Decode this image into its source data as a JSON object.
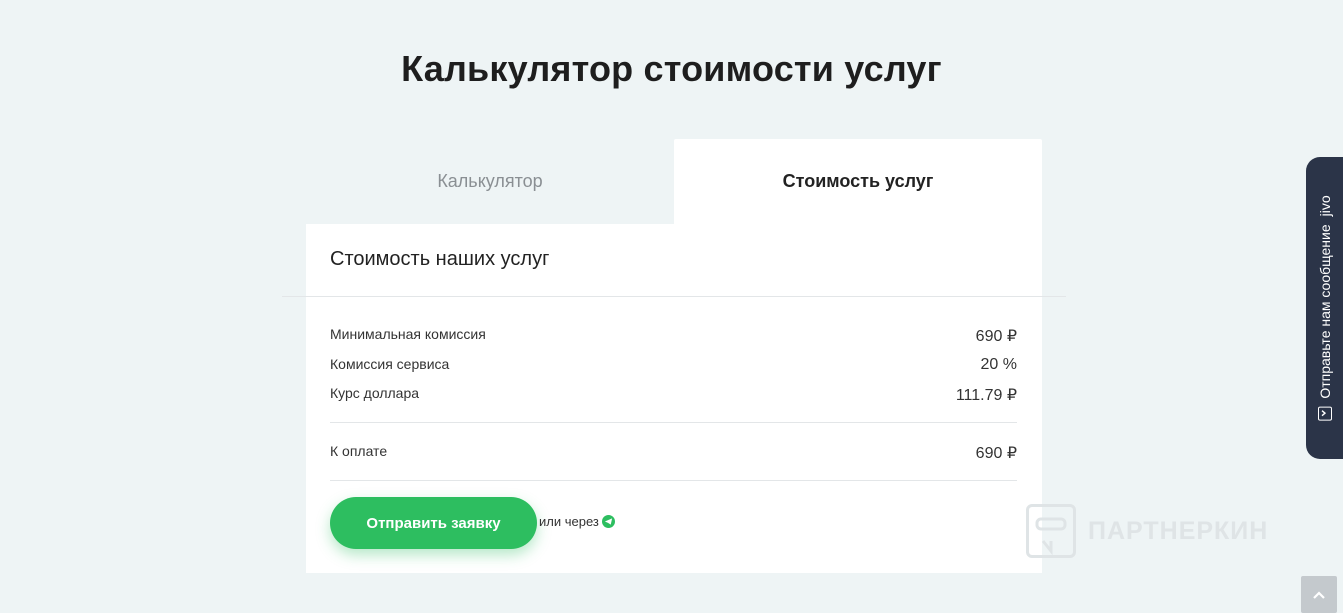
{
  "page": {
    "title": "Калькулятор стоимости услуг"
  },
  "tabs": [
    {
      "label": "Калькулятор",
      "active": false
    },
    {
      "label": "Стоимость услуг",
      "active": true
    }
  ],
  "card": {
    "title": "Стоимость наших услуг",
    "rows": [
      {
        "label": "Минимальная комиссия",
        "value": "690 ₽"
      },
      {
        "label": "Комиссия сервиса",
        "value": "20 %"
      },
      {
        "label": "Курс доллара",
        "value": "111.79 ₽"
      }
    ],
    "total": {
      "label": "К оплате",
      "value": "690 ₽"
    },
    "submit_label": "Отправить заявку",
    "or_via": "или через"
  },
  "chat_widget": {
    "label": "Отправьте нам сообщение",
    "brand": "jivo"
  },
  "watermark": {
    "text": "ПАРТНЕРКИН"
  },
  "colors": {
    "accent": "#2dbe60",
    "background": "#eef4f5",
    "widget": "#2b3448"
  }
}
